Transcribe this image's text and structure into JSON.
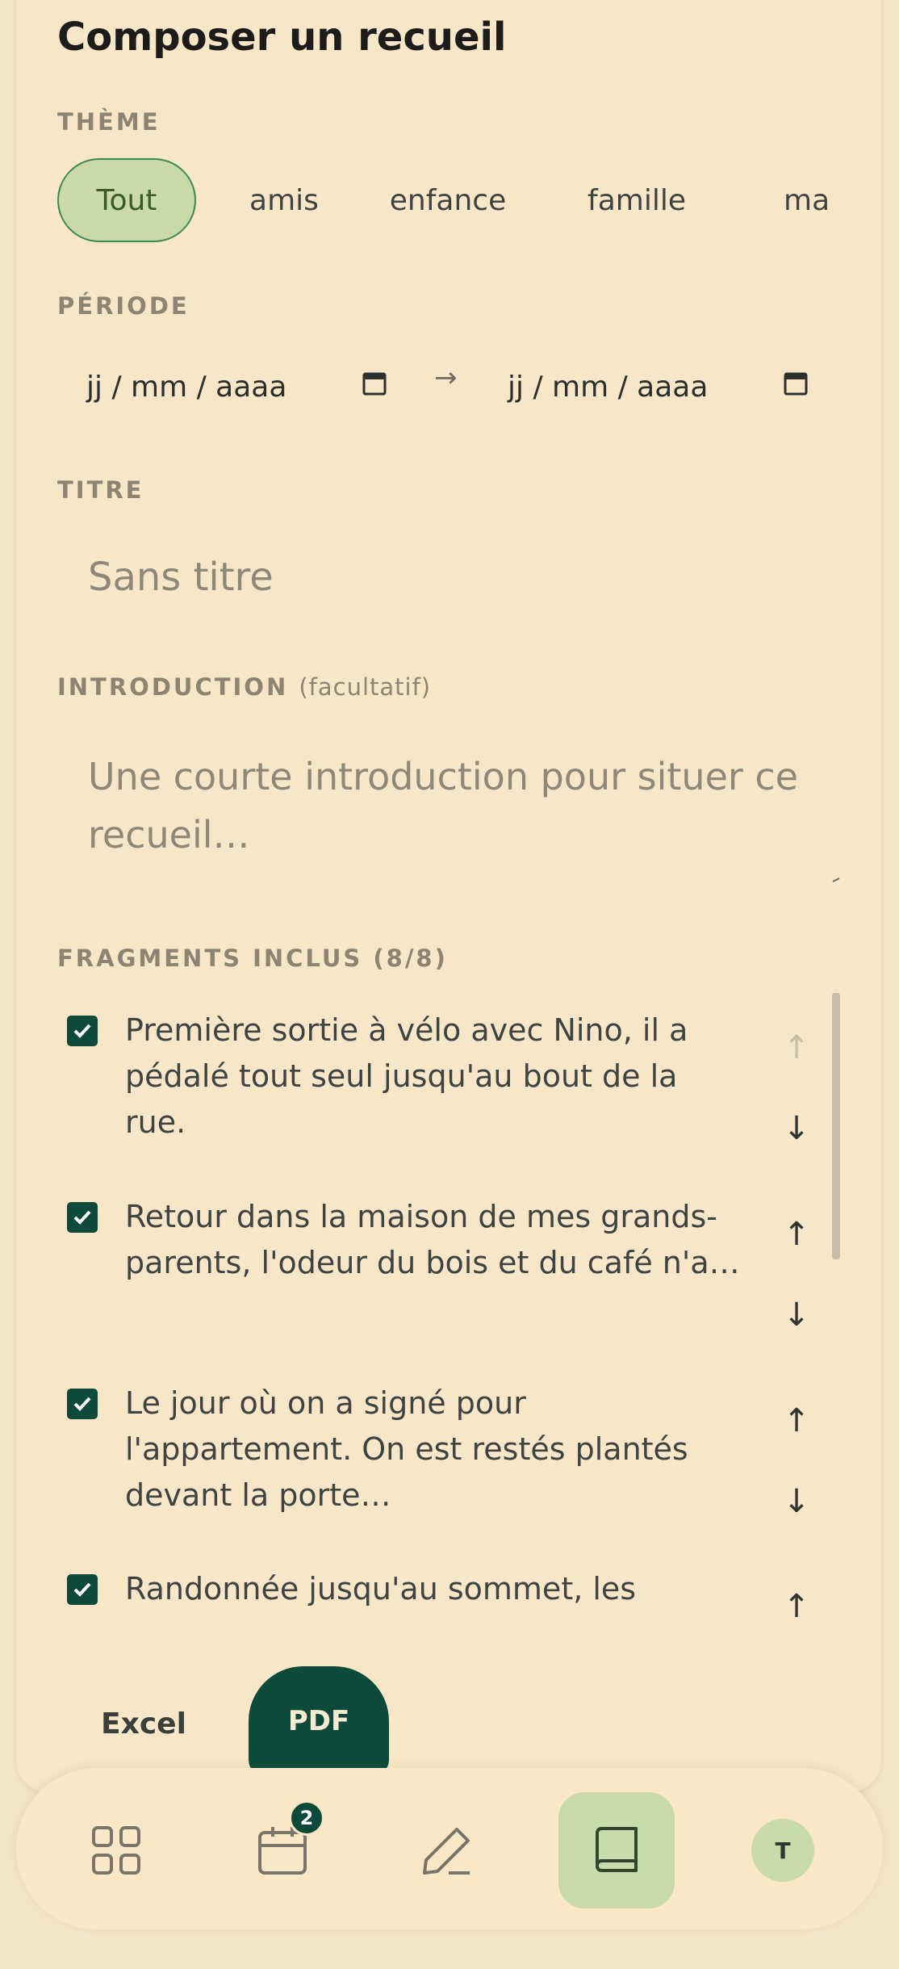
{
  "page": {
    "title": "Composer un recueil"
  },
  "theme": {
    "label": "THÈME",
    "chips": [
      "Tout",
      "amis",
      "enfance",
      "famille",
      "ma"
    ],
    "selected": "Tout"
  },
  "period": {
    "label": "PÉRIODE",
    "from_placeholder": "jj / mm / aaaa",
    "to_placeholder": "jj / mm / aaaa",
    "separator": "→"
  },
  "title_field": {
    "label": "TITRE",
    "placeholder": "Sans titre",
    "value": ""
  },
  "introduction": {
    "label": "INTRODUCTION",
    "hint": "(facultatif)",
    "placeholder": "Une courte introduction pour situer ce recueil…",
    "value": ""
  },
  "fragments": {
    "label": "FRAGMENTS INCLUS (8/8)",
    "items": [
      {
        "text": "Première sortie à vélo avec Nino, il a pédalé tout seul jusqu'au bout de la rue.",
        "checked": true
      },
      {
        "text": "Retour dans la maison de mes grands-parents, l'odeur du bois et du café n'a…",
        "checked": true
      },
      {
        "text": "Le jour où on a signé pour l'appartement. On est restés plantés devant la porte…",
        "checked": true
      },
      {
        "text": "Randonnée jusqu'au sommet, les",
        "checked": true
      }
    ],
    "move_up": "↑",
    "move_down": "↓"
  },
  "export": {
    "excel_label": "Excel",
    "pdf_label": "PDF"
  },
  "nav": {
    "items": [
      {
        "icon": "grid-icon"
      },
      {
        "icon": "calendar-icon",
        "badge": "2"
      },
      {
        "icon": "pencil-icon"
      },
      {
        "icon": "book-icon",
        "active": true
      },
      {
        "icon": "avatar",
        "initial": "T"
      }
    ]
  },
  "colors": {
    "accent": "#0d4a3a",
    "chip_active_bg": "#c9d9aa",
    "background": "#f8e6c9"
  }
}
